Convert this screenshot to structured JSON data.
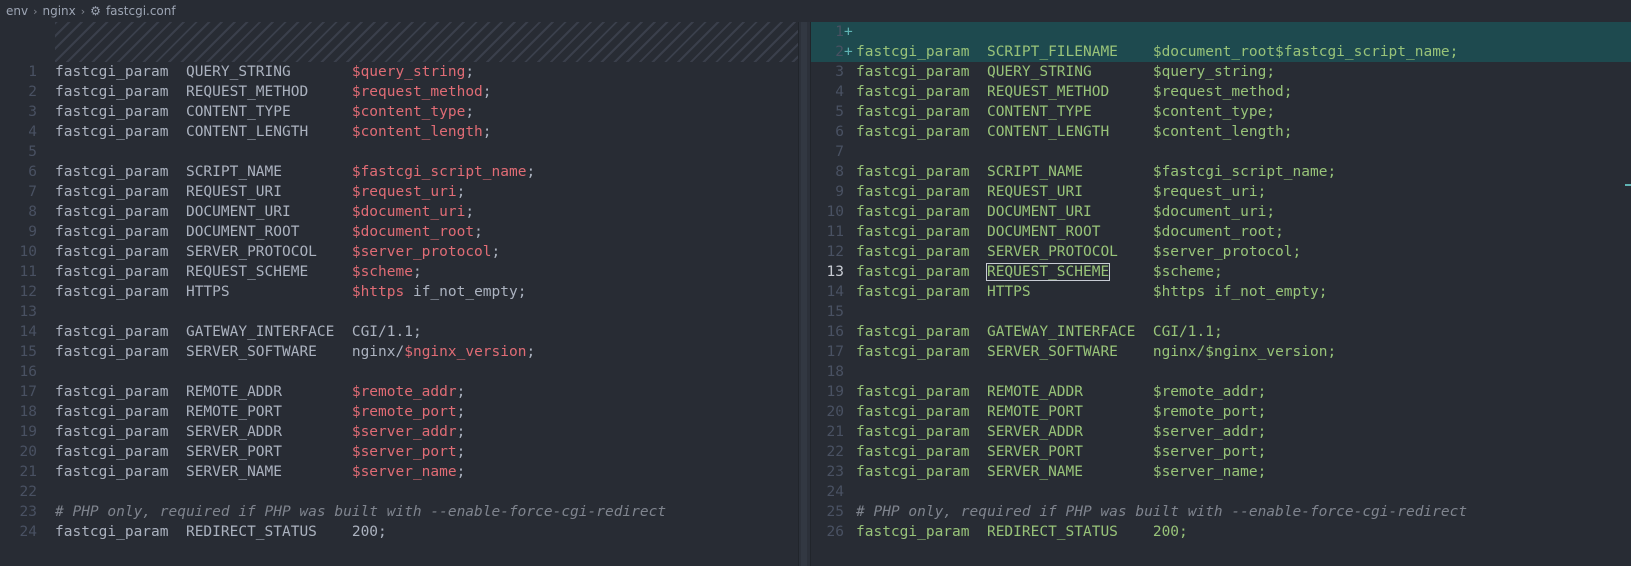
{
  "breadcrumb": {
    "items": [
      "env",
      "nginx",
      "fastcgi.conf"
    ],
    "file_icon": "gear-icon"
  },
  "left_pane": {
    "lines": [
      {
        "n": "1",
        "kw": "fastcgi_param",
        "param": "QUERY_STRING",
        "val": "$query_string",
        "end": ";"
      },
      {
        "n": "2",
        "kw": "fastcgi_param",
        "param": "REQUEST_METHOD",
        "val": "$request_method",
        "end": ";"
      },
      {
        "n": "3",
        "kw": "fastcgi_param",
        "param": "CONTENT_TYPE",
        "val": "$content_type",
        "end": ";"
      },
      {
        "n": "4",
        "kw": "fastcgi_param",
        "param": "CONTENT_LENGTH",
        "val": "$content_length",
        "end": ";"
      },
      {
        "n": "5",
        "blank": true
      },
      {
        "n": "6",
        "kw": "fastcgi_param",
        "param": "SCRIPT_NAME",
        "val": "$fastcgi_script_name",
        "end": ";"
      },
      {
        "n": "7",
        "kw": "fastcgi_param",
        "param": "REQUEST_URI",
        "val": "$request_uri",
        "end": ";"
      },
      {
        "n": "8",
        "kw": "fastcgi_param",
        "param": "DOCUMENT_URI",
        "val": "$document_uri",
        "end": ";"
      },
      {
        "n": "9",
        "kw": "fastcgi_param",
        "param": "DOCUMENT_ROOT",
        "val": "$document_root",
        "end": ";"
      },
      {
        "n": "10",
        "kw": "fastcgi_param",
        "param": "SERVER_PROTOCOL",
        "val": "$server_protocol",
        "end": ";"
      },
      {
        "n": "11",
        "kw": "fastcgi_param",
        "param": "REQUEST_SCHEME",
        "val": "$scheme",
        "end": ";"
      },
      {
        "n": "12",
        "kw": "fastcgi_param",
        "param": "HTTPS",
        "val": "$https",
        "end": " if_not_empty;"
      },
      {
        "n": "13",
        "blank": true
      },
      {
        "n": "14",
        "kw": "fastcgi_param",
        "param": "GATEWAY_INTERFACE",
        "plain": "CGI/1.1",
        "end": ";"
      },
      {
        "n": "15",
        "kw": "fastcgi_param",
        "param": "SERVER_SOFTWARE",
        "plain": "nginx/",
        "val": "$nginx_version",
        "end": ";"
      },
      {
        "n": "16",
        "blank": true
      },
      {
        "n": "17",
        "kw": "fastcgi_param",
        "param": "REMOTE_ADDR",
        "val": "$remote_addr",
        "end": ";"
      },
      {
        "n": "18",
        "kw": "fastcgi_param",
        "param": "REMOTE_PORT",
        "val": "$remote_port",
        "end": ";"
      },
      {
        "n": "19",
        "kw": "fastcgi_param",
        "param": "SERVER_ADDR",
        "val": "$server_addr",
        "end": ";"
      },
      {
        "n": "20",
        "kw": "fastcgi_param",
        "param": "SERVER_PORT",
        "val": "$server_port",
        "end": ";"
      },
      {
        "n": "21",
        "kw": "fastcgi_param",
        "param": "SERVER_NAME",
        "val": "$server_name",
        "end": ";"
      },
      {
        "n": "22",
        "blank": true
      },
      {
        "n": "23",
        "comment": "# PHP only, required if PHP was built with --enable-force-cgi-redirect"
      },
      {
        "n": "24",
        "kw": "fastcgi_param",
        "param": "REDIRECT_STATUS",
        "plain": "200",
        "end": ";"
      }
    ]
  },
  "right_pane": {
    "lines": [
      {
        "n": "1",
        "mark": "+",
        "added": true,
        "blank": true
      },
      {
        "n": "2",
        "mark": "+",
        "added": true,
        "kw": "fastcgi_param",
        "param": "SCRIPT_FILENAME",
        "val": "$document_root$fastcgi_script_name",
        "end": ";"
      },
      {
        "n": "3",
        "kw": "fastcgi_param",
        "param": "QUERY_STRING",
        "val": "$query_string",
        "end": ";"
      },
      {
        "n": "4",
        "kw": "fastcgi_param",
        "param": "REQUEST_METHOD",
        "val": "$request_method",
        "end": ";"
      },
      {
        "n": "5",
        "kw": "fastcgi_param",
        "param": "CONTENT_TYPE",
        "val": "$content_type",
        "end": ";"
      },
      {
        "n": "6",
        "kw": "fastcgi_param",
        "param": "CONTENT_LENGTH",
        "val": "$content_length",
        "end": ";"
      },
      {
        "n": "7",
        "blank": true
      },
      {
        "n": "8",
        "kw": "fastcgi_param",
        "param": "SCRIPT_NAME",
        "val": "$fastcgi_script_name",
        "end": ";"
      },
      {
        "n": "9",
        "kw": "fastcgi_param",
        "param": "REQUEST_URI",
        "val": "$request_uri",
        "end": ";"
      },
      {
        "n": "10",
        "kw": "fastcgi_param",
        "param": "DOCUMENT_URI",
        "val": "$document_uri",
        "end": ";"
      },
      {
        "n": "11",
        "kw": "fastcgi_param",
        "param": "DOCUMENT_ROOT",
        "val": "$document_root",
        "end": ";"
      },
      {
        "n": "12",
        "kw": "fastcgi_param",
        "param": "SERVER_PROTOCOL",
        "val": "$server_protocol",
        "end": ";"
      },
      {
        "n": "13",
        "current": true,
        "kw": "fastcgi_param",
        "param": "REQUEST_SCHEME",
        "boxed": true,
        "val": "$scheme",
        "end": ";"
      },
      {
        "n": "14",
        "kw": "fastcgi_param",
        "param": "HTTPS",
        "val": "$https",
        "end": " if_not_empty;"
      },
      {
        "n": "15",
        "blank": true
      },
      {
        "n": "16",
        "kw": "fastcgi_param",
        "param": "GATEWAY_INTERFACE",
        "plain": "CGI/1.1",
        "end": ";"
      },
      {
        "n": "17",
        "kw": "fastcgi_param",
        "param": "SERVER_SOFTWARE",
        "plain": "nginx/",
        "val": "$nginx_version",
        "end": ";"
      },
      {
        "n": "18",
        "blank": true
      },
      {
        "n": "19",
        "kw": "fastcgi_param",
        "param": "REMOTE_ADDR",
        "val": "$remote_addr",
        "end": ";"
      },
      {
        "n": "20",
        "kw": "fastcgi_param",
        "param": "REMOTE_PORT",
        "val": "$remote_port",
        "end": ";"
      },
      {
        "n": "21",
        "kw": "fastcgi_param",
        "param": "SERVER_ADDR",
        "val": "$server_addr",
        "end": ";"
      },
      {
        "n": "22",
        "kw": "fastcgi_param",
        "param": "SERVER_PORT",
        "val": "$server_port",
        "end": ";"
      },
      {
        "n": "23",
        "kw": "fastcgi_param",
        "param": "SERVER_NAME",
        "val": "$server_name",
        "end": ";"
      },
      {
        "n": "24",
        "blank": true
      },
      {
        "n": "25",
        "comment": "# PHP only, required if PHP was built with --enable-force-cgi-redirect"
      },
      {
        "n": "26",
        "kw": "fastcgi_param",
        "param": "REDIRECT_STATUS",
        "plain": "200",
        "end": ";"
      }
    ]
  },
  "colors": {
    "background": "#282c34",
    "variable_left": "#e06c75",
    "text_right": "#98c379",
    "added_line": "#1e4a4f",
    "comment": "#7f848e"
  }
}
